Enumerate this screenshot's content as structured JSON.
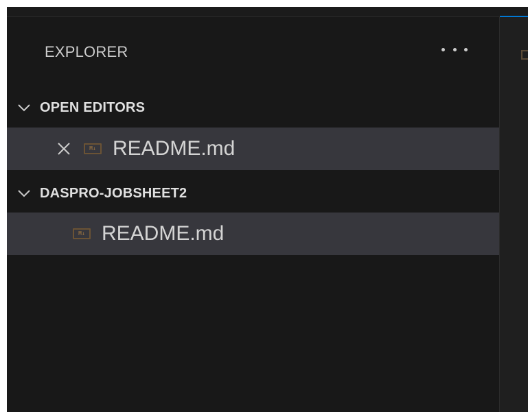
{
  "explorer": {
    "title": "EXPLORER",
    "more_icon": "ellipsis-icon"
  },
  "open_editors": {
    "label": "OPEN EDITORS",
    "chevron_icon": "chevron-down-icon",
    "items": [
      {
        "label": "README.md",
        "icon": "markdown-icon",
        "close_icon": "close-icon",
        "badge": "M↓"
      }
    ]
  },
  "workspace": {
    "label": "DASPRO-JOBSHEET2",
    "chevron_icon": "chevron-down-icon",
    "items": [
      {
        "label": "README.md",
        "icon": "markdown-icon",
        "badge": "M↓"
      }
    ]
  },
  "colors": {
    "background": "#181818",
    "selected_row": "#37373d",
    "accent": "#0078d4",
    "markdown_icon": "#6b5335"
  }
}
